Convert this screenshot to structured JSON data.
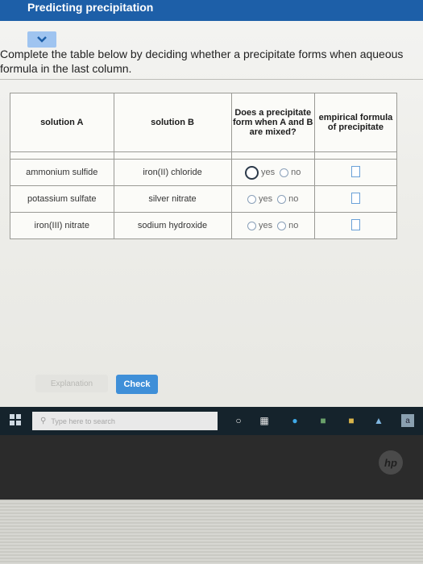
{
  "window": {
    "title": "Predicting precipitation"
  },
  "instructions": {
    "line1": "Complete the table below by deciding whether a precipitate forms when aqueous",
    "line2": "formula in the last column."
  },
  "table": {
    "headers": [
      "solution A",
      "solution B",
      "Does a precipitate form when A and B are mixed?",
      "empirical formula of precipitate"
    ],
    "rows": [
      {
        "a": "ammonium sulfide",
        "b": "iron(II) chloride",
        "yes": "yes",
        "no": "no"
      },
      {
        "a": "potassium sulfate",
        "b": "silver nitrate",
        "yes": "yes",
        "no": "no"
      },
      {
        "a": "iron(III) nitrate",
        "b": "sodium hydroxide",
        "yes": "yes",
        "no": "no"
      }
    ]
  },
  "buttons": {
    "explanation": "Explanation",
    "check": "Check"
  },
  "taskbar": {
    "search_placeholder": "Type here to search"
  },
  "colors": {
    "titlebar": "#1d5fa8",
    "check_button": "#3f8fd8",
    "chevron_button": "#9fc4f0"
  }
}
